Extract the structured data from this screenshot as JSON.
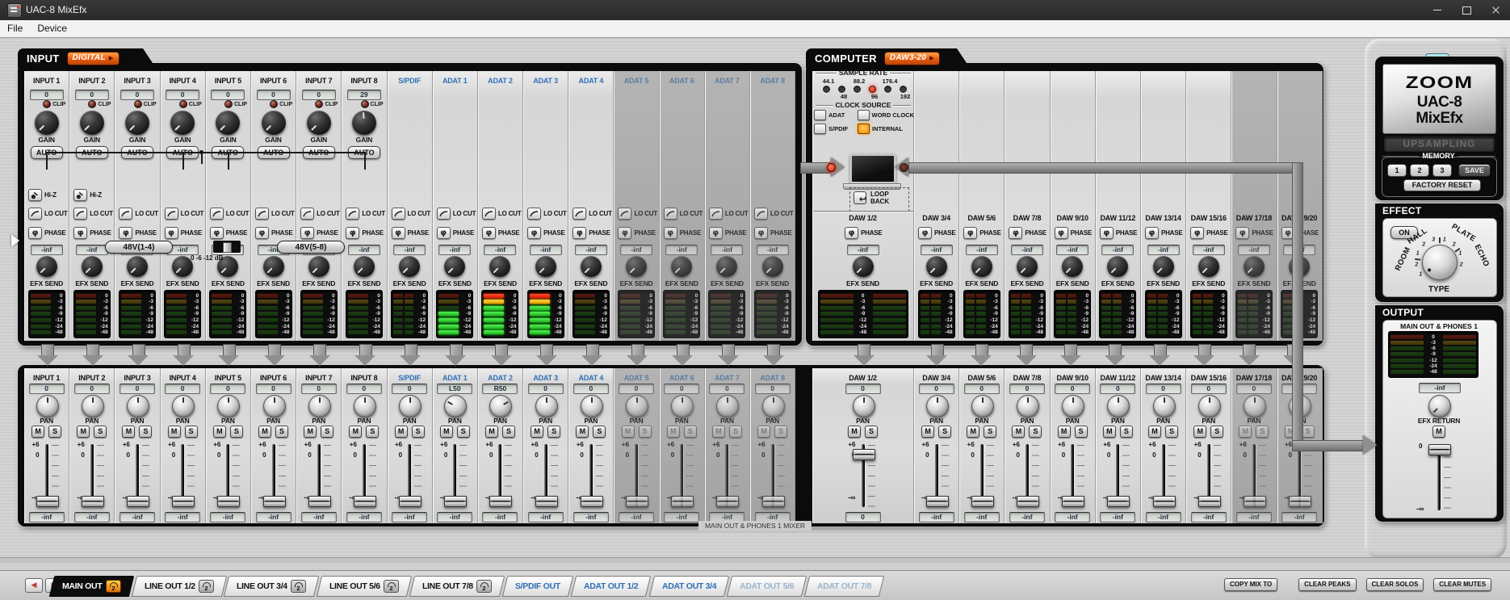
{
  "window": {
    "title": "UAC-8 MixEfx",
    "menu": [
      "File",
      "Device"
    ]
  },
  "icons": {
    "phase": "φ",
    "loopback": "↩",
    "badge_arrow": "▶",
    "scroll_left": "◀",
    "scroll_right": "▶"
  },
  "colors": {
    "accent_blue": "#2f6fb5",
    "badge_orange": "#e8641c",
    "led_red": "#ff2012",
    "lit_orange": "#f28a00",
    "meter_green": "#3ce23c",
    "meter_yellow": "#ffc423",
    "meter_red": "#f03018"
  },
  "input_section": {
    "title": "INPUT",
    "badge": "DIGITAL",
    "row_labels": {
      "clip": "CLIP",
      "gain": "GAIN",
      "auto": "AUTO",
      "hiz": "Hi-Z",
      "locut": "LO CUT",
      "phase": "PHASE",
      "efx": "EFX SEND"
    },
    "phantom": {
      "group1": "48V(1-4)",
      "group2": "48V(5-8)",
      "pad_label": "0 -6 -12 dB"
    },
    "efx_value": "-inf",
    "meter_scale": [
      "0",
      "-3",
      "-6",
      "-9",
      "-12",
      "-24",
      "-48"
    ],
    "channels": [
      {
        "label": "INPUT 1",
        "value": "0",
        "kind": "analog",
        "hiz": true
      },
      {
        "label": "INPUT 2",
        "value": "0",
        "kind": "analog",
        "hiz": true
      },
      {
        "label": "INPUT 3",
        "value": "0",
        "kind": "analog"
      },
      {
        "label": "INPUT 4",
        "value": "0",
        "kind": "analog"
      },
      {
        "label": "INPUT 5",
        "value": "0",
        "kind": "analog"
      },
      {
        "label": "INPUT 6",
        "value": "0",
        "kind": "analog"
      },
      {
        "label": "INPUT 7",
        "value": "0",
        "kind": "analog"
      },
      {
        "label": "INPUT 8",
        "value": "29",
        "kind": "analog"
      },
      {
        "label": "S/PDIF",
        "kind": "digital",
        "accent": true,
        "stereo": true
      },
      {
        "label": "ADAT 1",
        "kind": "digital",
        "accent": true,
        "meter_lit": 4
      },
      {
        "label": "ADAT 2",
        "kind": "digital",
        "accent": true,
        "meter_lit": 7
      },
      {
        "label": "ADAT 3",
        "kind": "digital",
        "accent": true,
        "meter_lit": 7
      },
      {
        "label": "ADAT 4",
        "kind": "digital",
        "accent": true
      },
      {
        "label": "ADAT 5",
        "kind": "digital",
        "accent": true,
        "disabled": true
      },
      {
        "label": "ADAT 6",
        "kind": "digital",
        "accent": true,
        "disabled": true
      },
      {
        "label": "ADAT 7",
        "kind": "digital",
        "accent": true,
        "disabled": true
      },
      {
        "label": "ADAT 8",
        "kind": "digital",
        "accent": true,
        "disabled": true
      }
    ]
  },
  "computer_section": {
    "title": "COMPUTER",
    "badge": "DAW3-20",
    "sample_rate": {
      "title": "SAMPLE RATE",
      "top": [
        "44.1",
        "88.2",
        "176.4"
      ],
      "bottom": [
        "48",
        "96",
        "192"
      ],
      "active": "96"
    },
    "clock_source": {
      "title": "CLOCK SOURCE",
      "options": [
        "ADAT",
        "WORD CLOCK",
        "S/PDIF",
        "INTERNAL"
      ],
      "active": "INTERNAL"
    },
    "loopback": {
      "line1": "LOOP",
      "line2": "BACK"
    },
    "row_labels": {
      "phase": "PHASE",
      "efx": "EFX SEND"
    },
    "efx_value": "-inf",
    "daw_channels": [
      {
        "label": "DAW 1/2",
        "wide": true
      },
      {
        "label": "DAW 3/4"
      },
      {
        "label": "DAW 5/6"
      },
      {
        "label": "DAW 7/8"
      },
      {
        "label": "DAW 9/10"
      },
      {
        "label": "DAW 11/12"
      },
      {
        "label": "DAW 13/14"
      },
      {
        "label": "DAW 15/16"
      },
      {
        "label": "DAW 17/18",
        "disabled": true
      },
      {
        "label": "DAW 19/20",
        "disabled": true
      }
    ]
  },
  "device_panel": {
    "brand": "ZOOM",
    "model": "UAC-8",
    "app": "MixEfx",
    "upsampling": "UPSAMPLING",
    "memory": {
      "title": "MEMORY",
      "slots": [
        "1",
        "2",
        "3"
      ],
      "save": "SAVE",
      "factory_reset": "FACTORY RESET"
    }
  },
  "effect_section": {
    "title": "EFFECT",
    "on": "ON",
    "type_label": "TYPE",
    "types": [
      {
        "name": "ROOM",
        "numbers": [
          "1",
          "2"
        ]
      },
      {
        "name": "HALL",
        "numbers": [
          "1",
          "2",
          "3"
        ]
      },
      {
        "name": "PLATE",
        "numbers": [
          "1",
          "2"
        ]
      },
      {
        "name": "ECHO",
        "numbers": [
          "1",
          "2"
        ]
      }
    ]
  },
  "output_section": {
    "title": "OUTPUT",
    "bus": "MAIN OUT & PHONES 1",
    "meter_scale": [
      "0",
      "-3",
      "-6",
      "-9",
      "-12",
      "-24",
      "-48"
    ],
    "efx_value": "-inf",
    "efx_return": "EFX RETURN",
    "mute": "M",
    "fader_top": "0",
    "fader_bottom": "-∞"
  },
  "mixer": {
    "footer": "MAIN OUT & PHONES 1 MIXER",
    "labels": {
      "pan": "PAN",
      "mute": "M",
      "solo": "S",
      "plus6": "+6",
      "zero": "0",
      "minusinf": "-∞"
    },
    "channels": [
      {
        "label": "INPUT 1",
        "pan": "0",
        "fader": "-inf"
      },
      {
        "label": "INPUT 2",
        "pan": "0",
        "fader": "-inf"
      },
      {
        "label": "INPUT 3",
        "pan": "0",
        "fader": "-inf"
      },
      {
        "label": "INPUT 4",
        "pan": "0",
        "fader": "-inf"
      },
      {
        "label": "INPUT 5",
        "pan": "0",
        "fader": "-inf"
      },
      {
        "label": "INPUT 6",
        "pan": "0",
        "fader": "-inf"
      },
      {
        "label": "INPUT 7",
        "pan": "0",
        "fader": "-inf"
      },
      {
        "label": "INPUT 8",
        "pan": "0",
        "fader": "-inf"
      },
      {
        "label": "S/PDIF",
        "pan": "0",
        "fader": "-inf",
        "accent": true
      },
      {
        "label": "ADAT 1",
        "pan": "L50",
        "fader": "-inf",
        "accent": true
      },
      {
        "label": "ADAT 2",
        "pan": "R50",
        "fader": "-inf",
        "accent": true
      },
      {
        "label": "ADAT 3",
        "pan": "0",
        "fader": "-inf",
        "accent": true
      },
      {
        "label": "ADAT 4",
        "pan": "0",
        "fader": "-inf",
        "accent": true
      },
      {
        "label": "ADAT 5",
        "pan": "0",
        "fader": "-inf",
        "accent": true,
        "disabled": true
      },
      {
        "label": "ADAT 6",
        "pan": "0",
        "fader": "-inf",
        "accent": true,
        "disabled": true
      },
      {
        "label": "ADAT 7",
        "pan": "0",
        "fader": "-inf",
        "accent": true,
        "disabled": true
      },
      {
        "label": "ADAT 8",
        "pan": "0",
        "fader": "-inf",
        "accent": true,
        "disabled": true
      }
    ],
    "daw_channels": [
      {
        "label": "DAW 1/2",
        "pan": "0",
        "fader": "0",
        "wide": true
      },
      {
        "label": "DAW 3/4",
        "pan": "0",
        "fader": "-inf"
      },
      {
        "label": "DAW 5/6",
        "pan": "0",
        "fader": "-inf"
      },
      {
        "label": "DAW 7/8",
        "pan": "0",
        "fader": "-inf"
      },
      {
        "label": "DAW 9/10",
        "pan": "0",
        "fader": "-inf"
      },
      {
        "label": "DAW 11/12",
        "pan": "0",
        "fader": "-inf"
      },
      {
        "label": "DAW 13/14",
        "pan": "0",
        "fader": "-inf"
      },
      {
        "label": "DAW 15/16",
        "pan": "0",
        "fader": "-inf"
      },
      {
        "label": "DAW 17/18",
        "pan": "0",
        "fader": "-inf",
        "disabled": true
      },
      {
        "label": "DAW 19/20",
        "pan": "0",
        "fader": "-inf",
        "disabled": true
      }
    ]
  },
  "tabbar": {
    "tabs": [
      {
        "label": "MAIN OUT",
        "active": true,
        "badge": "2"
      },
      {
        "label": "LINE OUT 1/2",
        "badge": "2"
      },
      {
        "label": "LINE OUT 3/4",
        "badge": "2"
      },
      {
        "label": "LINE OUT 5/6",
        "badge": "2"
      },
      {
        "label": "LINE OUT 7/8",
        "badge": "2"
      },
      {
        "label": "S/PDIF OUT",
        "color": "blue"
      },
      {
        "label": "ADAT OUT 1/2",
        "color": "blue"
      },
      {
        "label": "ADAT OUT 3/4",
        "color": "blue"
      },
      {
        "label": "ADAT OUT 5/6",
        "color": "blue",
        "disabled": true
      },
      {
        "label": "ADAT OUT 7/8",
        "color": "blue",
        "disabled": true
      }
    ],
    "actions": [
      "COPY MIX TO",
      "CLEAR PEAKS",
      "CLEAR SOLOS",
      "CLEAR MUTES"
    ]
  }
}
